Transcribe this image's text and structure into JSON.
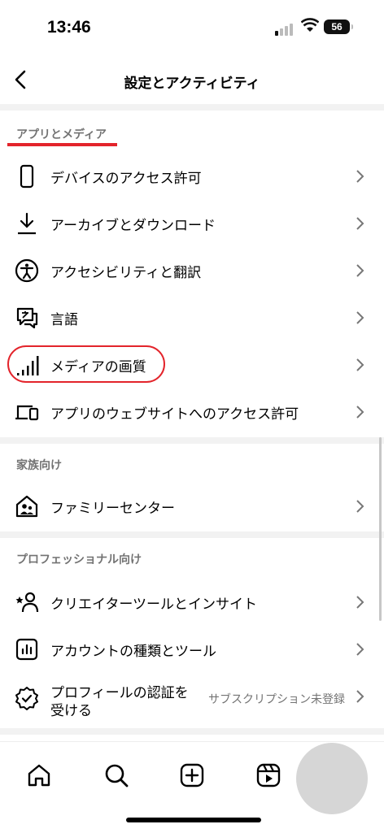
{
  "status": {
    "time": "13:46",
    "battery": "56"
  },
  "header": {
    "title": "設定とアクティビティ"
  },
  "sections": {
    "apps": {
      "label": "アプリとメディア",
      "items": [
        {
          "label": "デバイスのアクセス許可",
          "icon": "phone-icon"
        },
        {
          "label": "アーカイブとダウンロード",
          "icon": "download-icon"
        },
        {
          "label": "アクセシビリティと翻訳",
          "icon": "accessibility-icon"
        },
        {
          "label": "言語",
          "icon": "language-icon"
        },
        {
          "label": "メディアの画質",
          "icon": "signal-bars-icon"
        },
        {
          "label": "アプリのウェブサイトへのアクセス許可",
          "icon": "laptop-phone-icon"
        }
      ]
    },
    "family": {
      "label": "家族向け",
      "items": [
        {
          "label": "ファミリーセンター",
          "icon": "family-home-icon"
        }
      ]
    },
    "pro": {
      "label": "プロフェッショナル向け",
      "items": [
        {
          "label": "クリエイターツールとインサイト",
          "icon": "creator-star-icon"
        },
        {
          "label": "アカウントの種類とツール",
          "icon": "chart-icon"
        },
        {
          "label_line1": "プロフィールの認証を",
          "label_line2": "受ける",
          "sub": "サブスクリプション未登録",
          "icon": "verified-badge-icon"
        }
      ]
    }
  },
  "nav": [
    "home-icon",
    "search-icon",
    "create-icon",
    "reels-icon"
  ]
}
